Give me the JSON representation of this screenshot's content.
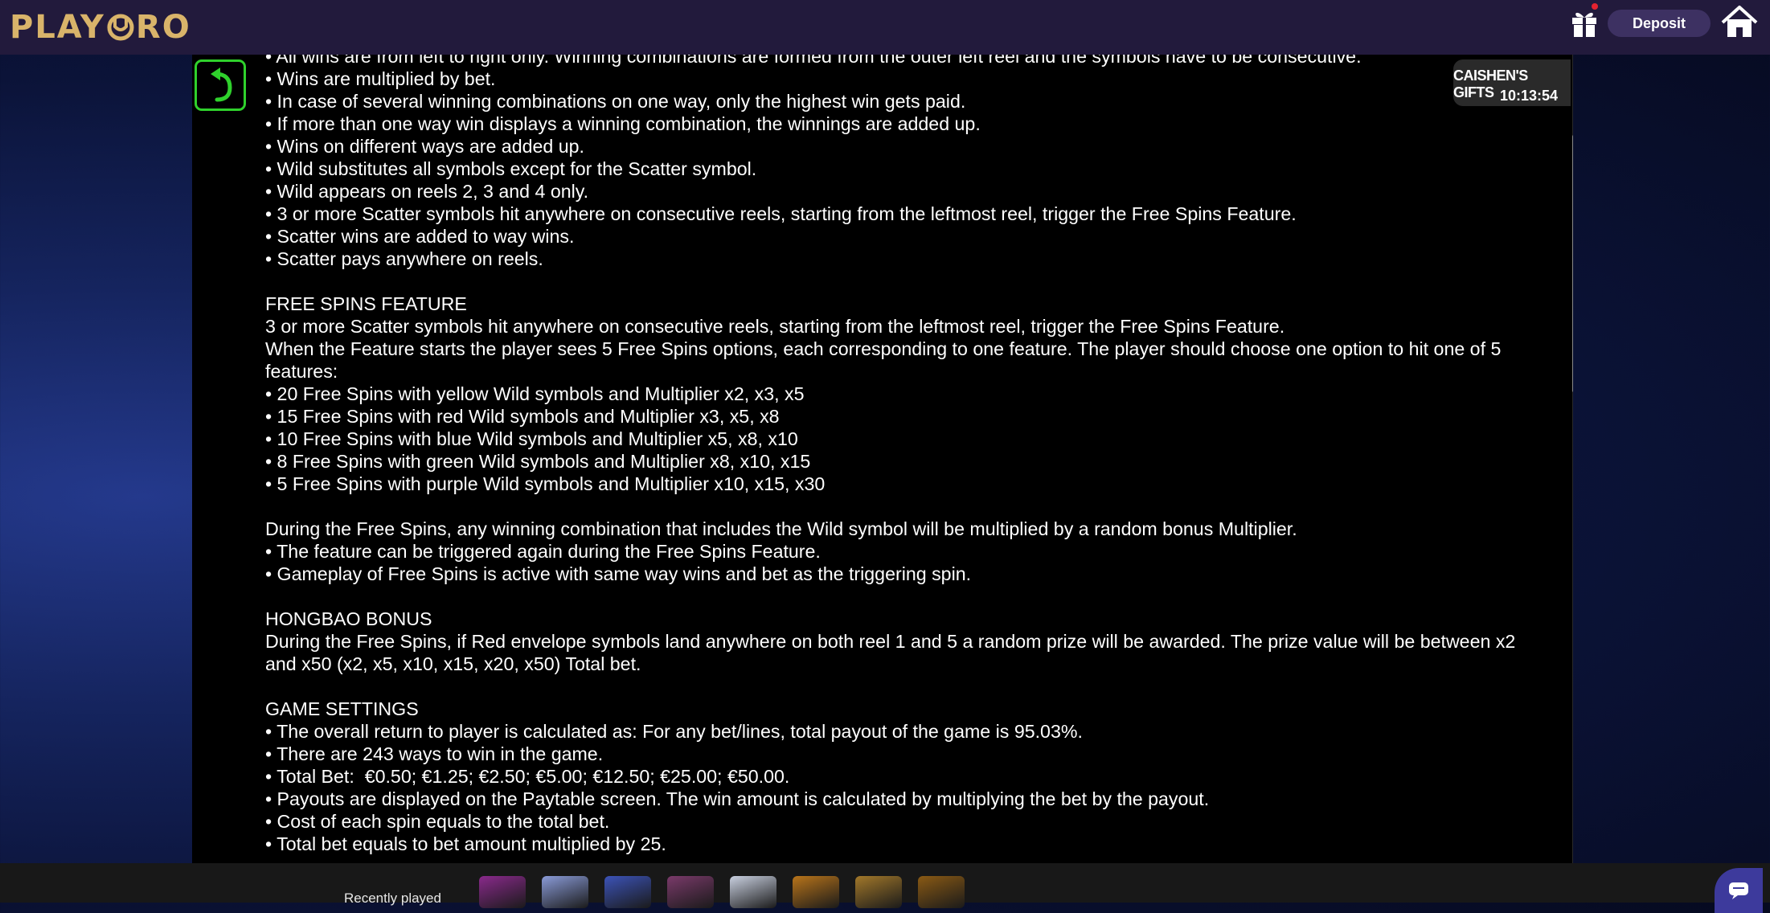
{
  "header": {
    "logo_left": "PLAY",
    "logo_right": "RO",
    "deposit_label": "Deposit",
    "gift_icon": "gift-icon",
    "home_icon": "home-icon"
  },
  "game": {
    "badge_title": "CAISHEN'S GIFTS",
    "badge_time": "10:13:54",
    "rules_lines": [
      "• All wins are from left to right only. Winning combinations are formed from the outer left reel and the symbols have to be consecutive.",
      "• Wins are multiplied by bet.",
      "• In case of several winning combinations on one way, only the highest win gets paid.",
      "• If more than one way win displays a winning combination, the winnings are added up.",
      "• Wins on different ways are added up.",
      "• Wild substitutes all symbols except for the Scatter symbol.",
      "• Wild appears on reels 2, 3 and 4 only.",
      "• 3 or more Scatter symbols hit anywhere on consecutive reels, starting from the leftmost reel, trigger the Free Spins Feature.",
      "• Scatter wins are added to way wins.",
      "• Scatter pays anywhere on reels.",
      "",
      "FREE SPINS FEATURE",
      "3 or more Scatter symbols hit anywhere on consecutive reels, starting from the leftmost reel, trigger the Free Spins Feature.",
      "When the Feature starts the player sees 5 Free Spins options, each corresponding to one feature. The player should choose one option to hit one of 5 features:",
      "• 20 Free Spins with yellow Wild symbols and Multiplier x2, x3, x5",
      "• 15 Free Spins with red Wild symbols and Multiplier x3, x5, x8",
      "• 10 Free Spins with blue Wild symbols and Multiplier x5, x8, x10",
      "• 8 Free Spins with green Wild symbols and Multiplier x8, x10, x15",
      "• 5 Free Spins with purple Wild symbols and Multiplier x10, x15, x30",
      "",
      "During the Free Spins, any winning combination that includes the Wild symbol will be multiplied by a random bonus Multiplier.",
      "• The feature can be triggered again during the Free Spins Feature.",
      "• Gameplay of Free Spins is active with same way wins and bet as the triggering spin.",
      "",
      "HONGBAO BONUS",
      "During the Free Spins, if Red envelope symbols land anywhere on both reel 1 and 5 a random prize will be awarded. The prize value will be between x2 and x50 (x2, x5, x10, x15, x20, x50) Total bet.",
      "",
      "GAME SETTINGS",
      "• The overall return to player is calculated as: For any bet/lines, total payout of the game is 95.03%.",
      "• There are 243 ways to win in the game.",
      "• Total Bet:  €0.50; €1.25; €2.50; €5.00; €12.50; €25.00; €50.00.",
      "• Payouts are displayed on the Paytable screen. The win amount is calculated by multiplying the bet by the payout.",
      "• Cost of each spin equals to the total bet.",
      "• Total bet equals to bet amount multiplied by 25."
    ]
  },
  "footer": {
    "recently_played_label": "Recently played",
    "thumbnails": [
      {
        "icon": "game-thumb-joker",
        "color": "#8a2a8c"
      },
      {
        "icon": "game-thumb-blocks",
        "color": "#8a9bd8"
      },
      {
        "icon": "game-thumb-777",
        "color": "#3c53b8"
      },
      {
        "icon": "game-thumb-fruits",
        "color": "#7a3a6a"
      },
      {
        "icon": "game-thumb-eagle",
        "color": "#c9d0e0"
      },
      {
        "icon": "game-thumb-dragon",
        "color": "#b8741a"
      },
      {
        "icon": "game-thumb-pharaoh",
        "color": "#a2782a"
      },
      {
        "icon": "game-thumb-gold",
        "color": "#8a5a14"
      }
    ],
    "chat_icon": "chat-icon"
  }
}
